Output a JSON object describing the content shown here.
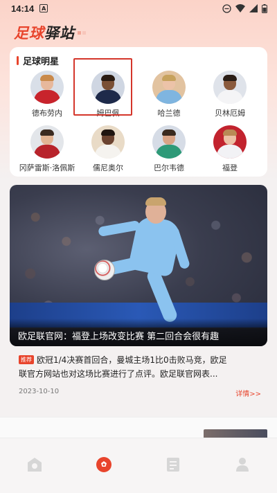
{
  "status_bar": {
    "time": "14:14",
    "notif_letter": "A"
  },
  "header": {
    "title_red": "足球",
    "title_dark": "驿站"
  },
  "stars": {
    "title": "足球明星",
    "players": [
      {
        "name": "德布劳内"
      },
      {
        "name": "姆巴佩"
      },
      {
        "name": "哈兰德"
      },
      {
        "name": "贝林厄姆"
      },
      {
        "name": "冈萨雷斯·洛佩斯"
      },
      {
        "name": "儒尼奥尔"
      },
      {
        "name": "巴尔韦德"
      },
      {
        "name": "福登"
      }
    ]
  },
  "news": {
    "caption": "欧足联官网：福登上场改变比赛 第二回合会很有趣",
    "tag": "推荐",
    "summary_line1": "欧冠1/4决赛首回合，曼城主场1比0击败马竞，欧足",
    "summary_line2": "联官方网站也对这场比赛进行了点评。欧足联官网表...",
    "date": "2023-10-10",
    "more": "详情>>"
  },
  "tabbar": {
    "active_color": "#e8442c",
    "inactive_color": "#cfcfcf",
    "icons": [
      "home-icon",
      "football-icon",
      "news-icon",
      "profile-icon"
    ]
  }
}
